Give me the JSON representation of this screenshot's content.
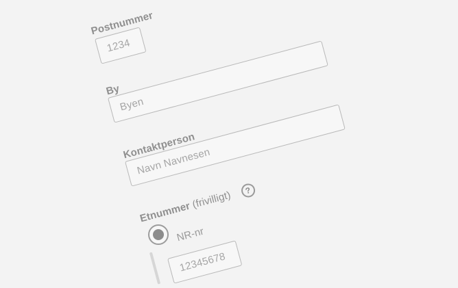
{
  "form": {
    "postal_code": {
      "label": "Postnummer",
      "value": "1234"
    },
    "city": {
      "label": "By",
      "value": "Byen"
    },
    "contact_person": {
      "label": "Kontaktperson",
      "value": "Navn Navnesen"
    },
    "unit_number": {
      "label": "Etnummer",
      "optional_text": "(frivilligt)",
      "help_icon": "question-circle-icon",
      "help_glyph": "?",
      "radio_label": "NR-nr",
      "radio_selected": true,
      "value": "12345678"
    }
  }
}
